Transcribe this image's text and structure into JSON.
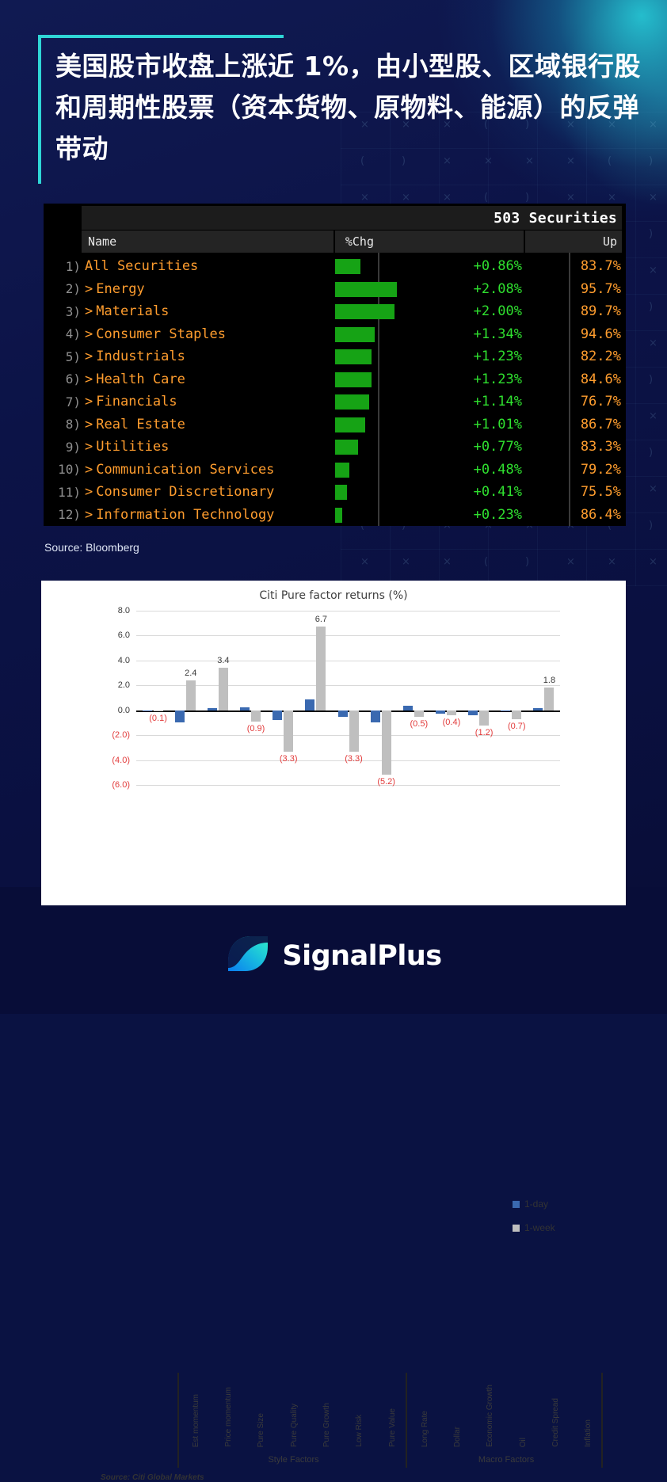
{
  "theme": {
    "accent_cyan": "#2fd6d6",
    "bg_navy": "#0a1242",
    "bbg_orange": "#ff9d2e",
    "bbg_green": "#2fe02f",
    "bar_blue": "#3a69b0",
    "bar_gray": "#bfbfbf",
    "neg_red": "#e23b3b"
  },
  "headline": {
    "text": "美国股市收盘上涨近 1%，由小型股、区域银行股和周期性股票（资本货物、原物料、能源）的反弹带动"
  },
  "bloomberg": {
    "securities_count_label": "503 Securities",
    "columns": {
      "name": "Name",
      "chg": "%Chg",
      "up": "Up"
    },
    "source": "Source: Bloomberg",
    "rows": [
      {
        "idx": "1)",
        "expand": "",
        "name": "All Securities",
        "chg": "+0.86%",
        "up": "83.7%",
        "chg_value": 0.86
      },
      {
        "idx": "2)",
        "expand": ">",
        "name": "Energy",
        "chg": "+2.08%",
        "up": "95.7%",
        "chg_value": 2.08
      },
      {
        "idx": "3)",
        "expand": ">",
        "name": "Materials",
        "chg": "+2.00%",
        "up": "89.7%",
        "chg_value": 2.0
      },
      {
        "idx": "4)",
        "expand": ">",
        "name": "Consumer Staples",
        "chg": "+1.34%",
        "up": "94.6%",
        "chg_value": 1.34
      },
      {
        "idx": "5)",
        "expand": ">",
        "name": "Industrials",
        "chg": "+1.23%",
        "up": "82.2%",
        "chg_value": 1.23
      },
      {
        "idx": "6)",
        "expand": ">",
        "name": "Health Care",
        "chg": "+1.23%",
        "up": "84.6%",
        "chg_value": 1.23
      },
      {
        "idx": "7)",
        "expand": ">",
        "name": "Financials",
        "chg": "+1.14%",
        "up": "76.7%",
        "chg_value": 1.14
      },
      {
        "idx": "8)",
        "expand": ">",
        "name": "Real Estate",
        "chg": "+1.01%",
        "up": "86.7%",
        "chg_value": 1.01
      },
      {
        "idx": "9)",
        "expand": ">",
        "name": "Utilities",
        "chg": "+0.77%",
        "up": "83.3%",
        "chg_value": 0.77
      },
      {
        "idx": "10)",
        "expand": ">",
        "name": "Communication Services",
        "chg": "+0.48%",
        "up": "79.2%",
        "chg_value": 0.48
      },
      {
        "idx": "11)",
        "expand": ">",
        "name": "Consumer Discretionary",
        "chg": "+0.41%",
        "up": "75.5%",
        "chg_value": 0.41
      },
      {
        "idx": "12)",
        "expand": ">",
        "name": "Information Technology",
        "chg": "+0.23%",
        "up": "86.4%",
        "chg_value": 0.23
      }
    ]
  },
  "chart_data": {
    "type": "bar",
    "title": "Citi Pure factor returns (%)",
    "xlabel": "",
    "ylabel": "",
    "ylim": [
      -6.0,
      8.0
    ],
    "yticks": [
      "8.0",
      "6.0",
      "4.0",
      "2.0",
      "0.0",
      "(2.0)",
      "(4.0)",
      "(6.0)"
    ],
    "ytick_values": [
      8.0,
      6.0,
      4.0,
      2.0,
      0.0,
      -2.0,
      -4.0,
      -6.0
    ],
    "grid": true,
    "legend_position": "top-right",
    "categories": [
      "Est momentum",
      "Price momentum",
      "Pure Size",
      "Pure Quality",
      "Pure Growth",
      "Low Risk",
      "Pure Value",
      "Long Rate",
      "Dollar",
      "Economic Growth",
      "Oil",
      "Credit Spread",
      "Inflation"
    ],
    "group_captions": [
      {
        "label": "Style Factors",
        "categories": 7
      },
      {
        "label": "Macro Factors",
        "categories": 6
      }
    ],
    "series": [
      {
        "name": "1-day",
        "color": "#3a69b0",
        "values": [
          0.0,
          -1.0,
          0.2,
          0.25,
          -0.8,
          0.9,
          -0.5,
          -1.0,
          0.35,
          -0.3,
          -0.4,
          -0.1,
          0.15
        ],
        "labels": [
          "",
          "",
          "",
          "",
          "",
          "",
          "",
          "",
          "",
          "",
          "",
          "",
          ""
        ]
      },
      {
        "name": "1-week",
        "color": "#bfbfbf",
        "values": [
          -0.1,
          2.4,
          3.4,
          -0.9,
          -3.3,
          6.7,
          -3.3,
          -5.2,
          -0.5,
          -0.4,
          -1.2,
          -0.7,
          1.8
        ],
        "labels": [
          "(0.1)",
          "2.4",
          "3.4",
          "(0.9)",
          "(3.3)",
          "6.7",
          "(3.3)",
          "(5.2)",
          "(0.5)",
          "(0.4)",
          "(1.2)",
          "(0.7)",
          "1.8"
        ]
      }
    ],
    "source": "Source: Citi Global Markets"
  },
  "footer": {
    "brand": "SignalPlus"
  }
}
